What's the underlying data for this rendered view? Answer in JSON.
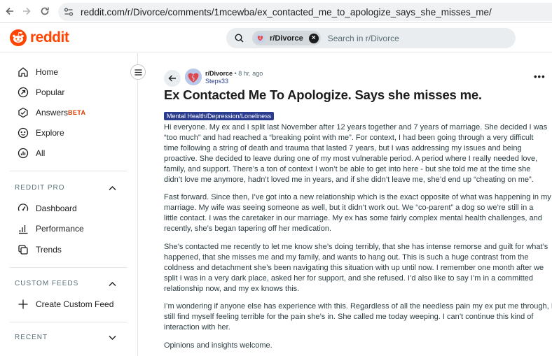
{
  "browser": {
    "url": "reddit.com/r/Divorce/comments/1mcewba/ex_contacted_me_to_apologize_says_she_misses_me/"
  },
  "header": {
    "logo_text": "reddit",
    "search": {
      "chip_label": "r/Divorce",
      "placeholder": "Search in r/Divorce"
    }
  },
  "sidebar": {
    "main_items": [
      {
        "label": "Home",
        "icon": "home-icon"
      },
      {
        "label": "Popular",
        "icon": "popular-icon"
      },
      {
        "label": "Answers",
        "icon": "answers-icon",
        "badge": "BETA"
      },
      {
        "label": "Explore",
        "icon": "explore-icon"
      },
      {
        "label": "All",
        "icon": "all-icon"
      }
    ],
    "pro_section": {
      "title": "REDDIT PRO",
      "items": [
        {
          "label": "Dashboard",
          "icon": "dashboard-icon"
        },
        {
          "label": "Performance",
          "icon": "performance-icon"
        },
        {
          "label": "Trends",
          "icon": "trends-icon"
        }
      ]
    },
    "custom_feeds": {
      "title": "CUSTOM FEEDS",
      "create_label": "Create Custom Feed"
    },
    "recent": {
      "title": "RECENT"
    }
  },
  "post": {
    "subreddit": "r/Divorce",
    "age": "• 8 hr. ago",
    "author": "Steps33",
    "more_label": "•••",
    "title": "Ex Contacted Me To Apologize. Says she misses me.",
    "flair": "Mental Health/Depression/Loneliness",
    "paragraphs": [
      [
        "Hi everyone. My ex and I split last November after 12 years together and 7 years of marriage. She decided I was",
        "“too much” and had reached a “breaking point with me”. For context, I had been going through a very difficult",
        "time following a string of death and trauma that lasted 7 years, but I was addressing my issues and being",
        "proactive. She decided to leave during one of my most vulnerable period. A period where I really needed love,",
        "family, and support. There’s a ton of context I won’t be able to get into here - but she told me at the time she",
        "didn’t love me anymore, hadn’t loved me in years, and if she didn’t leave me, she’d end up “cheating on me”."
      ],
      [
        "Fast forward. Since then, I’ve got into a new relationship which is the exact opposite of what was happening in my",
        "marriage. My wife was seeing someone as well, but it didn’t work out. We “co-parent” a dog so we’re still in a",
        "little contact. I was the caretaker in our marriage. My ex has some fairly complex mental health challenges, and",
        "recently, she’s began tapering off her medication."
      ],
      [
        "She’s contacted me recently to let me know she’s doing terribly, that she has intense remorse and guilt for what’s",
        "happened, that she misses me and my family, and wants to hang out. This is such a huge contrast from the",
        "coldness and detachment she’s been navigating this situation with up until now. I remember one month after we",
        "split I was in a very dark place, asked her for support, and she refused. I’d also like to say I’m in a committed",
        "relationship now, and my ex knows this."
      ],
      [
        "I’m wondering if anyone else has experience with this. Regardless of all the needless pain my ex put me through, I",
        "still find myself feeling terrible for the pain she’s in. She called me today weeping. I can’t continue this kind of",
        "interaction with her."
      ],
      [
        "Opinions and insights welcome."
      ]
    ]
  },
  "colors": {
    "brand": "#ff4500",
    "flair_bg": "#2a3c8f",
    "beta": "#d93900"
  }
}
